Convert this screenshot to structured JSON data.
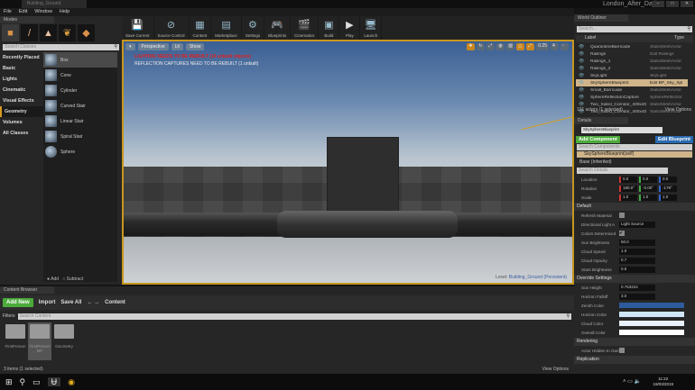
{
  "window": {
    "tab": "Building_Ground",
    "project": "London_After_Dark",
    "controls": [
      "–",
      "□",
      "✕"
    ]
  },
  "menu": [
    "File",
    "Edit",
    "Window",
    "Help"
  ],
  "modes": {
    "tab": "Modes",
    "search_placeholder": "Search Classes",
    "categories": [
      "Recently Placed",
      "Basic",
      "Lights",
      "Cinematic",
      "Visual Effects",
      "Geometry",
      "Volumes",
      "All Classes"
    ],
    "items": [
      "Box",
      "Cone",
      "Cylinder",
      "Curved Stair",
      "Linear Stair",
      "Spiral Stair",
      "Sphere"
    ],
    "add": "Add",
    "subtract": "Subtract"
  },
  "toolbar": [
    "Save Current",
    "Source Control",
    "Content",
    "Marketplace",
    "Settings",
    "Blueprints",
    "Cinematics",
    "Build",
    "Play",
    "Launch"
  ],
  "viewport": {
    "perspective": "Perspective",
    "lit": "Lit",
    "show": "Show",
    "warning_lighting": "LIGHTING NEEDS TO BE REBUILT (14 unbuilt objects)",
    "warning_reflection": "REFLECTION CAPTURES NEED TO BE REBUILT (1 unbuilt)",
    "snap_value": "0.25",
    "cam_speed": "4",
    "level_label": "Level:",
    "level_name": "Building_Ground (Persistent)"
  },
  "content_browser": {
    "tab": "Content Browser",
    "add_new": "Add New",
    "import": "Import",
    "save_all": "Save All",
    "path": "Content",
    "filters": "Filters",
    "search_placeholder": "Search Content",
    "folders": [
      "FirstPerson",
      "FirstPerson BP",
      "Geometry"
    ],
    "status": "3 items (1 selected)",
    "view_options": "View Options"
  },
  "outliner": {
    "tab": "World Outliner",
    "search_placeholder": "Search...",
    "col_label": "Label",
    "col_type": "Type",
    "rows": [
      {
        "label": "QuarantineBarricade",
        "type": "StaticMeshActor"
      },
      {
        "label": "Railings",
        "type": "Edit Railings"
      },
      {
        "label": "Railings_1",
        "type": "StaticMeshActor"
      },
      {
        "label": "Railings_2",
        "type": "StaticMeshActor"
      },
      {
        "label": "SkyLight",
        "type": "SkyLight"
      },
      {
        "label": "SkySphereBlueprint",
        "type": "Edit BP_Sky_Sphere"
      },
      {
        "label": "Small_Barricade",
        "type": "StaticMeshActor"
      },
      {
        "label": "SphereReflectionCapture",
        "type": "SphereReflectionCapture"
      },
      {
        "label": "Two_Sided_Corridor_400x400",
        "type": "StaticMeshActor"
      },
      {
        "label": "Two_Sided_Corridor_400x400",
        "type": "StaticMeshActor"
      }
    ],
    "status": "101 actors (1 selected)",
    "view_options": "View Options"
  },
  "details": {
    "tab": "Details",
    "name": "SkySphereBlueprint",
    "add_component": "Add Component",
    "edit_blueprint": "Edit Blueprint",
    "search_components": "Search Components",
    "self": "SkySphereBlueprint(self)",
    "base": "Base (Inherited)",
    "search_details": "Search Details",
    "transform": [
      {
        "label": "Location",
        "values": [
          "0.0",
          "0.0",
          "0.0"
        ]
      },
      {
        "label": "Rotation",
        "values": [
          "180.0°",
          "-0.00°",
          "-179°"
        ]
      },
      {
        "label": "Scale",
        "values": [
          "1.0",
          "1.0",
          "1.0"
        ]
      }
    ],
    "default_section": "Default",
    "default": [
      {
        "label": "Refresh Material",
        "value": ""
      },
      {
        "label": "Directional Light A",
        "value": "Light Source"
      },
      {
        "label": "Colors Determined",
        "value": "✔"
      },
      {
        "label": "Sun Brightness",
        "value": "50.0"
      },
      {
        "label": "Cloud Speed",
        "value": "1.0"
      },
      {
        "label": "Cloud Opacity",
        "value": "0.7"
      },
      {
        "label": "Stars Brightness",
        "value": "0.6"
      }
    ],
    "override_section": "Override Settings",
    "override": [
      {
        "label": "Sun Height",
        "value": "0.753224"
      },
      {
        "label": "Horizon Falloff",
        "value": "3.0"
      }
    ],
    "colors": [
      {
        "label": "Zenith Color",
        "color": "#2e5a9e"
      },
      {
        "label": "Horizon Color",
        "color": "#cfe6f8"
      },
      {
        "label": "Cloud Color",
        "color": "#e8f0fa"
      },
      {
        "label": "Overall Color",
        "color": "#ffffff"
      }
    ],
    "rendering_section": "Rendering",
    "actor_hidden": "Actor Hidden In Game",
    "replication_section": "Replication"
  },
  "taskbar": {
    "time": "11:22",
    "date": "19/03/2019"
  }
}
